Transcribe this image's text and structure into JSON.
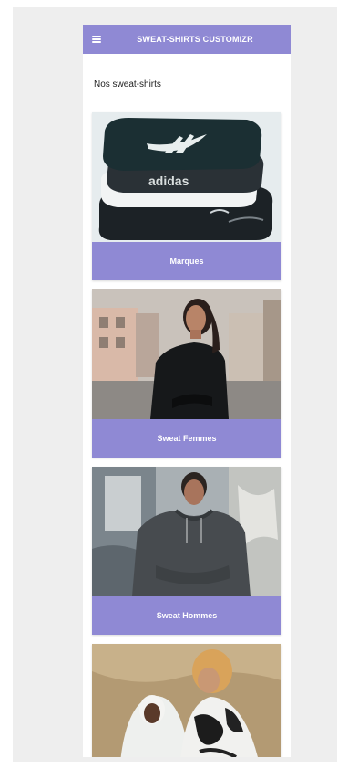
{
  "app": {
    "title": "SWEAT-SHIRTS CUSTOMIZR"
  },
  "section": {
    "title": "Nos sweat-shirts"
  },
  "cards": [
    {
      "label": "Marques",
      "image_icon": "brand-sweatshirts-stack-image"
    },
    {
      "label": "Sweat Femmes",
      "image_icon": "woman-sweatshirt-image"
    },
    {
      "label": "Sweat Hommes",
      "image_icon": "man-hoodie-image"
    },
    {
      "label": "",
      "image_icon": "couple-hoodies-image"
    }
  ],
  "brand_texts": {
    "logo_word": "adidas"
  },
  "colors": {
    "accent": "#8f89d4",
    "backdrop": "#eeeeee"
  }
}
